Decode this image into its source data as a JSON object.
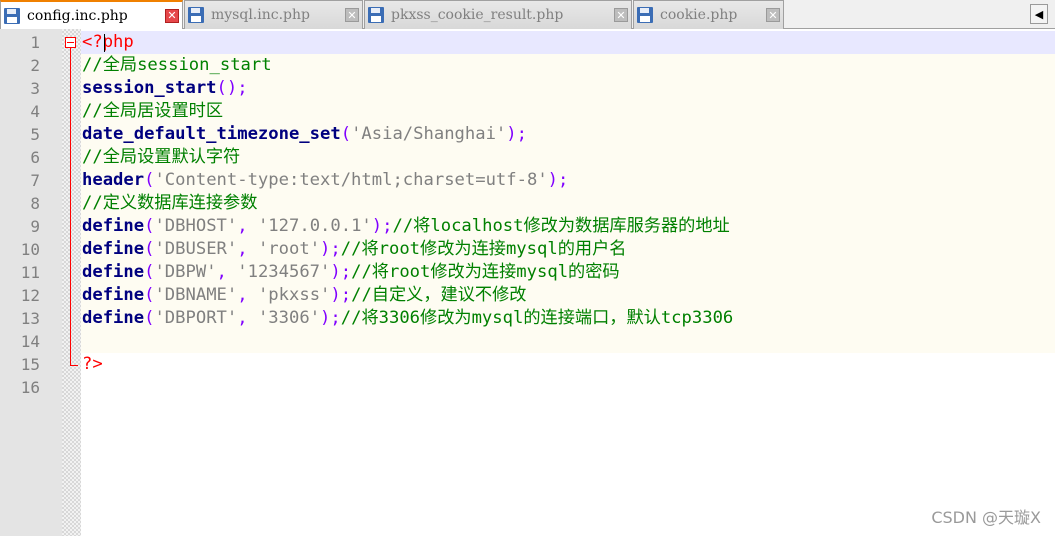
{
  "tabs": [
    {
      "label": "config.inc.php",
      "active": true
    },
    {
      "label": "mysql.inc.php",
      "active": false
    },
    {
      "label": "pkxss_cookie_result.php",
      "active": false
    },
    {
      "label": "cookie.php",
      "active": false
    }
  ],
  "tab_close_glyph": "✕",
  "tab_scroll_left": "◀",
  "colors": {
    "keyword": "#00007f",
    "comment": "#008000",
    "string": "#808080",
    "operator": "#8000ff",
    "php_tag": "#ff0000",
    "active_tab_accent": "#f08000"
  },
  "editor": {
    "lines": [
      {
        "num": "1",
        "tokens": [
          {
            "t": "<?",
            "c": "php-tag"
          },
          {
            "t": "php",
            "c": "php-tag"
          }
        ]
      },
      {
        "num": "2",
        "tokens": [
          {
            "t": "//全局session_start",
            "c": "cm"
          }
        ]
      },
      {
        "num": "3",
        "tokens": [
          {
            "t": "session_start",
            "c": "kw"
          },
          {
            "t": "();",
            "c": "op"
          }
        ]
      },
      {
        "num": "4",
        "tokens": [
          {
            "t": "//全局居设置时区",
            "c": "cm"
          }
        ]
      },
      {
        "num": "5",
        "tokens": [
          {
            "t": "date_default_timezone_set",
            "c": "kw"
          },
          {
            "t": "(",
            "c": "op"
          },
          {
            "t": "'Asia/Shanghai'",
            "c": "str"
          },
          {
            "t": ");",
            "c": "op"
          }
        ]
      },
      {
        "num": "6",
        "tokens": [
          {
            "t": "//全局设置默认字符",
            "c": "cm"
          }
        ]
      },
      {
        "num": "7",
        "tokens": [
          {
            "t": "header",
            "c": "kw"
          },
          {
            "t": "(",
            "c": "op"
          },
          {
            "t": "'Content-type:text/html;charset=utf-8'",
            "c": "str"
          },
          {
            "t": ");",
            "c": "op"
          }
        ]
      },
      {
        "num": "8",
        "tokens": [
          {
            "t": "//定义数据库连接参数",
            "c": "cm"
          }
        ]
      },
      {
        "num": "9",
        "tokens": [
          {
            "t": "define",
            "c": "kw"
          },
          {
            "t": "(",
            "c": "op"
          },
          {
            "t": "'DBHOST'",
            "c": "str"
          },
          {
            "t": ", ",
            "c": "op"
          },
          {
            "t": "'127.0.0.1'",
            "c": "str"
          },
          {
            "t": ");",
            "c": "op"
          },
          {
            "t": "//将localhost修改为数据库服务器的地址",
            "c": "cm"
          }
        ]
      },
      {
        "num": "10",
        "tokens": [
          {
            "t": "define",
            "c": "kw"
          },
          {
            "t": "(",
            "c": "op"
          },
          {
            "t": "'DBUSER'",
            "c": "str"
          },
          {
            "t": ", ",
            "c": "op"
          },
          {
            "t": "'root'",
            "c": "str"
          },
          {
            "t": ");",
            "c": "op"
          },
          {
            "t": "//将root修改为连接mysql的用户名",
            "c": "cm"
          }
        ]
      },
      {
        "num": "11",
        "tokens": [
          {
            "t": "define",
            "c": "kw"
          },
          {
            "t": "(",
            "c": "op"
          },
          {
            "t": "'DBPW'",
            "c": "str"
          },
          {
            "t": ", ",
            "c": "op"
          },
          {
            "t": "'1234567'",
            "c": "str"
          },
          {
            "t": ");",
            "c": "op"
          },
          {
            "t": "//将root修改为连接mysql的密码",
            "c": "cm"
          }
        ]
      },
      {
        "num": "12",
        "tokens": [
          {
            "t": "define",
            "c": "kw"
          },
          {
            "t": "(",
            "c": "op"
          },
          {
            "t": "'DBNAME'",
            "c": "str"
          },
          {
            "t": ", ",
            "c": "op"
          },
          {
            "t": "'pkxss'",
            "c": "str"
          },
          {
            "t": ");",
            "c": "op"
          },
          {
            "t": "//自定义，建议不修改",
            "c": "cm"
          }
        ]
      },
      {
        "num": "13",
        "tokens": [
          {
            "t": "define",
            "c": "kw"
          },
          {
            "t": "(",
            "c": "op"
          },
          {
            "t": "'DBPORT'",
            "c": "str"
          },
          {
            "t": ", ",
            "c": "op"
          },
          {
            "t": "'3306'",
            "c": "str"
          },
          {
            "t": ");",
            "c": "op"
          },
          {
            "t": "//将3306修改为mysql的连接端口，默认tcp3306",
            "c": "cm"
          }
        ]
      },
      {
        "num": "14",
        "tokens": []
      },
      {
        "num": "15",
        "tokens": [
          {
            "t": "?>",
            "c": "php-tag"
          }
        ]
      },
      {
        "num": "16",
        "tokens": []
      }
    ]
  },
  "watermark": "CSDN @天璇X"
}
